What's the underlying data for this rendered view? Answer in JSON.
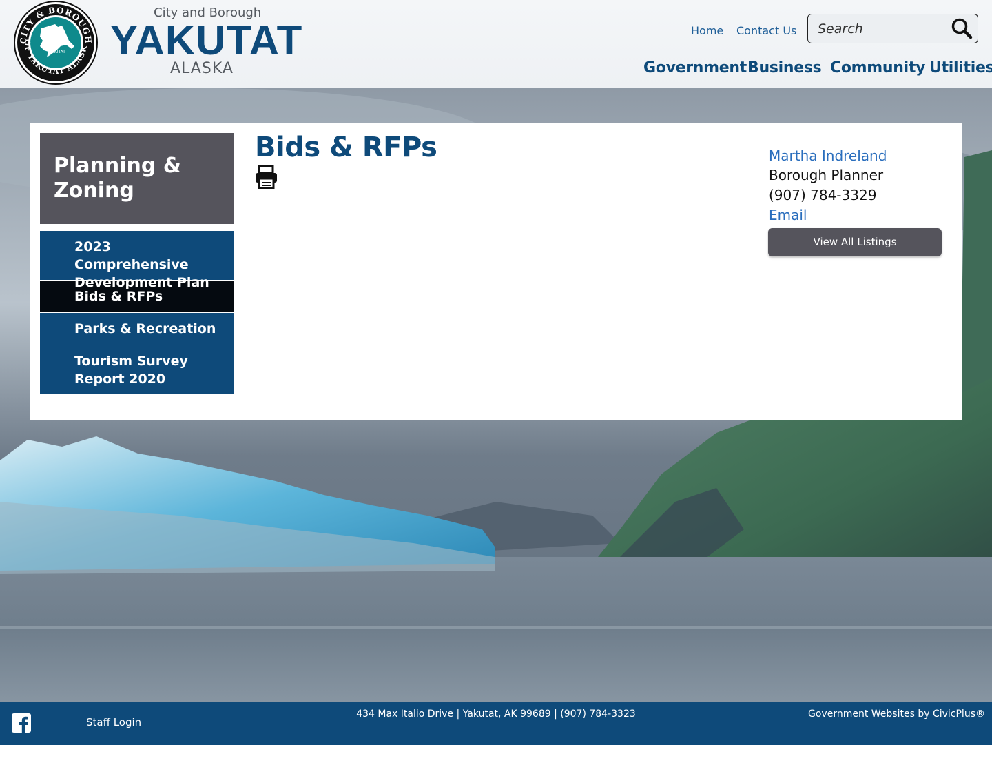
{
  "header": {
    "brand_top": "City and Borough",
    "brand_name": "YAKUTAT",
    "brand_sub": "ALASKA",
    "seal_text": "CITY & BOROUGH OF YAKUTAT ALASKA",
    "seal_inner": "YAKUTAT",
    "utility_links": [
      "Home",
      "Contact Us"
    ],
    "search_placeholder": "Search",
    "main_nav": [
      "Government",
      "Business",
      "Community",
      "Utilities"
    ]
  },
  "sidebar": {
    "title": "Planning & Zoning",
    "items": [
      {
        "label": "2023 Comprehensive Development Plan",
        "active": false
      },
      {
        "label": "Bids & RFPs",
        "active": true
      },
      {
        "label": "Parks & Recreation",
        "active": false
      },
      {
        "label": "Tourism Survey Report 2020",
        "active": false
      }
    ]
  },
  "main": {
    "title": "Bids & RFPs",
    "print_icon": "print-icon"
  },
  "contact": {
    "name": "Martha Indreland",
    "role": "Borough Planner",
    "phone": "(907) 784-3329",
    "email_label": "Email",
    "button_label": "View All Listings"
  },
  "footer": {
    "staff_login": "Staff Login",
    "address": "434 Max Italio Drive | Yakutat, AK 99689 | (907) 784-3323",
    "credit": "Government Websites by CivicPlus®"
  },
  "colors": {
    "brand_blue": "#0e4a7a",
    "link_blue": "#2a6ebd",
    "panel_gray": "#55545c",
    "active_nav": "#050a10"
  }
}
